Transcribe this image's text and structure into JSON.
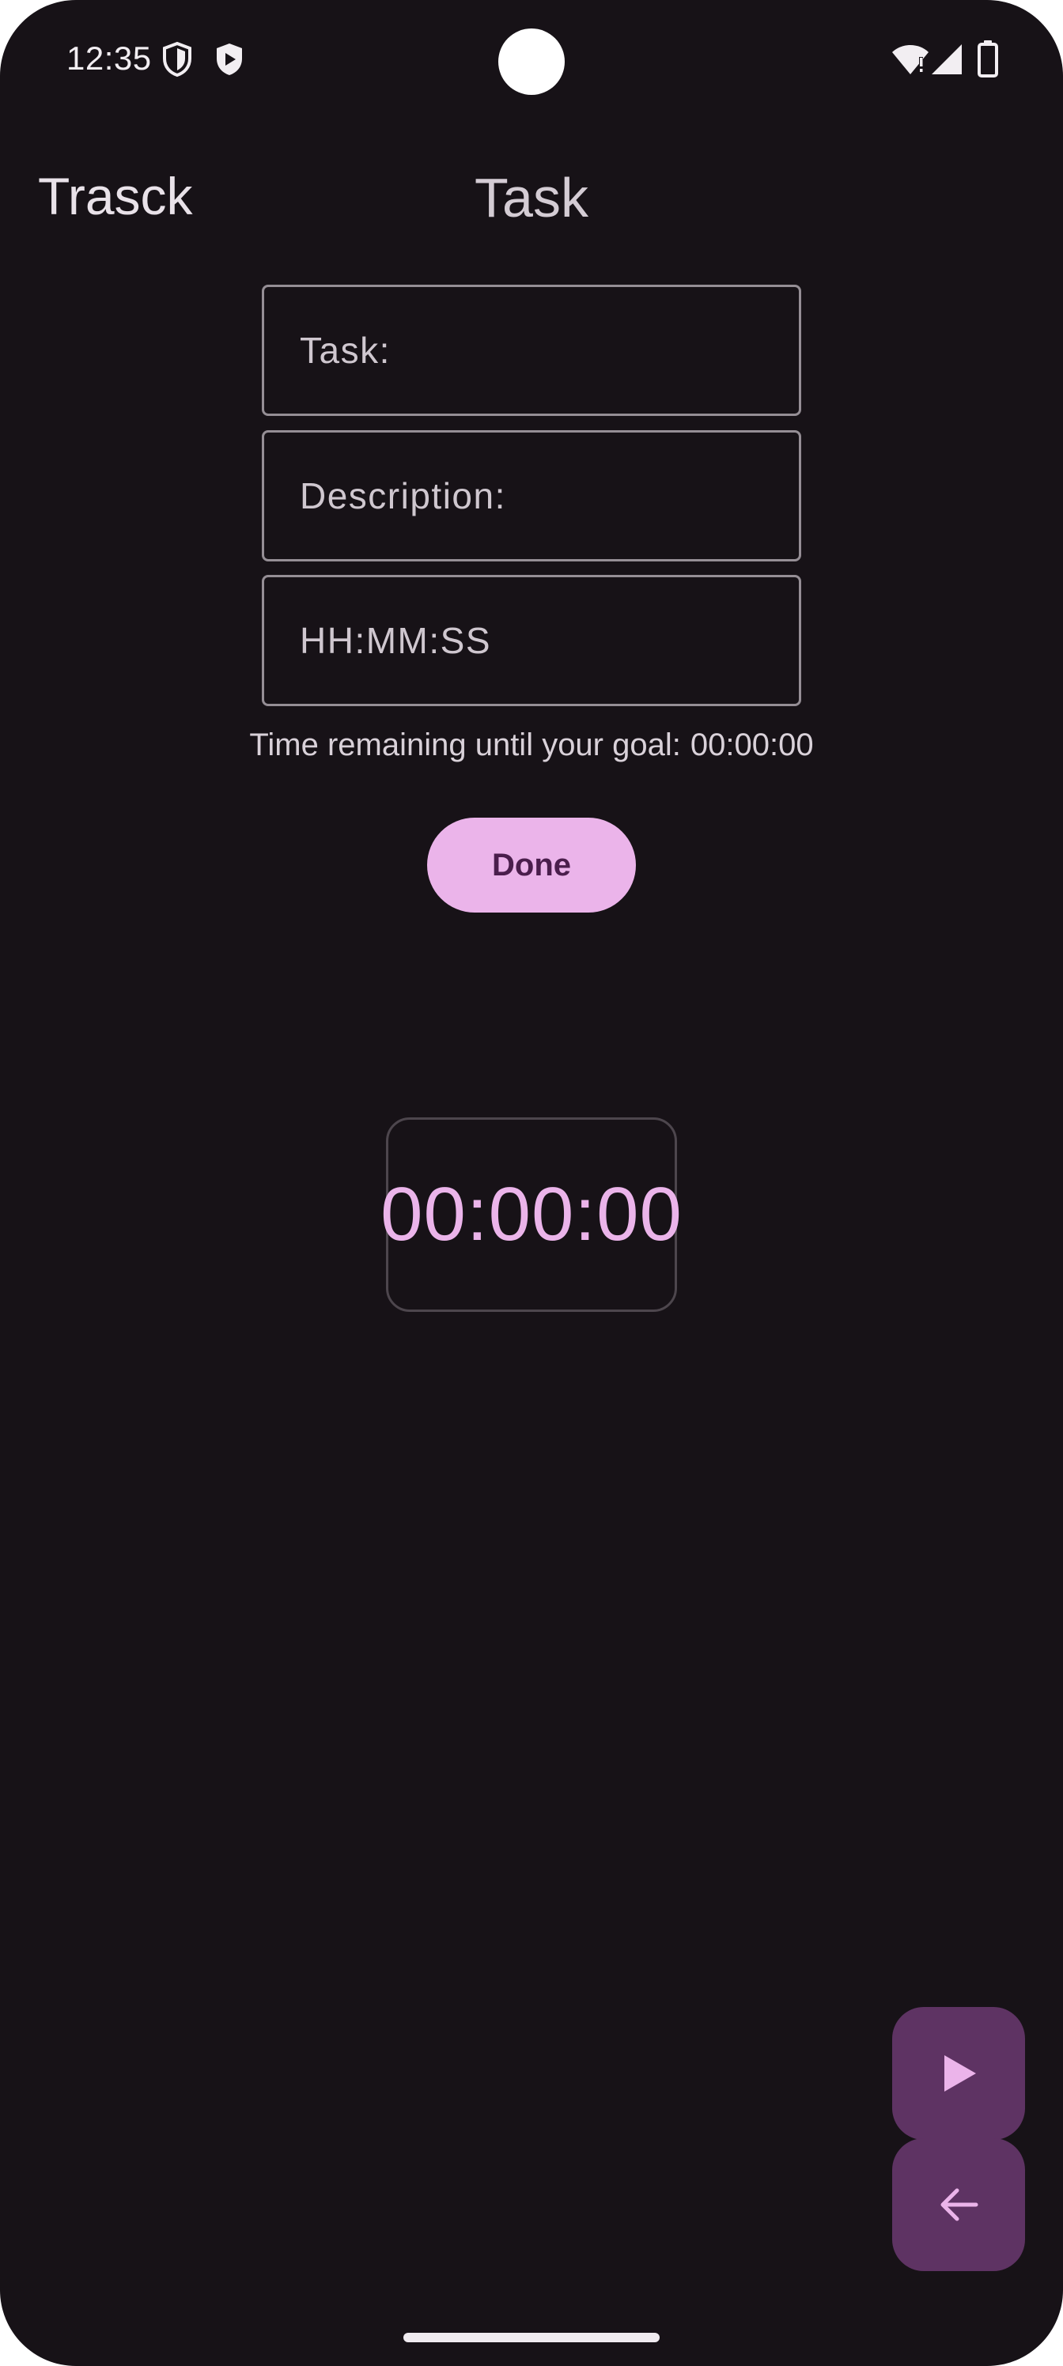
{
  "status_bar": {
    "time": "12:35",
    "left_icons": [
      "shield-outline-icon",
      "shield-play-icon"
    ],
    "right_icons": [
      "wifi-alert-icon",
      "cell-signal-icon",
      "battery-icon"
    ]
  },
  "header": {
    "app_name": "Trasck",
    "page_title": "Task"
  },
  "form": {
    "task_placeholder": "Task:",
    "task_value": "",
    "description_placeholder": "Description:",
    "description_value": "",
    "time_placeholder": "HH:MM:SS",
    "time_value": ""
  },
  "remaining": {
    "label": "Time remaining until your goal:",
    "value": "00:00:00"
  },
  "done_button": {
    "label": "Done"
  },
  "timer": {
    "display": "00:00:00"
  },
  "fabs": {
    "play_icon": "play-icon",
    "back_icon": "arrow-back-icon"
  },
  "colors": {
    "background": "#171217",
    "accent": "#ebb4ea",
    "fab": "#5e3363",
    "on_accent": "#4a1e4c"
  }
}
